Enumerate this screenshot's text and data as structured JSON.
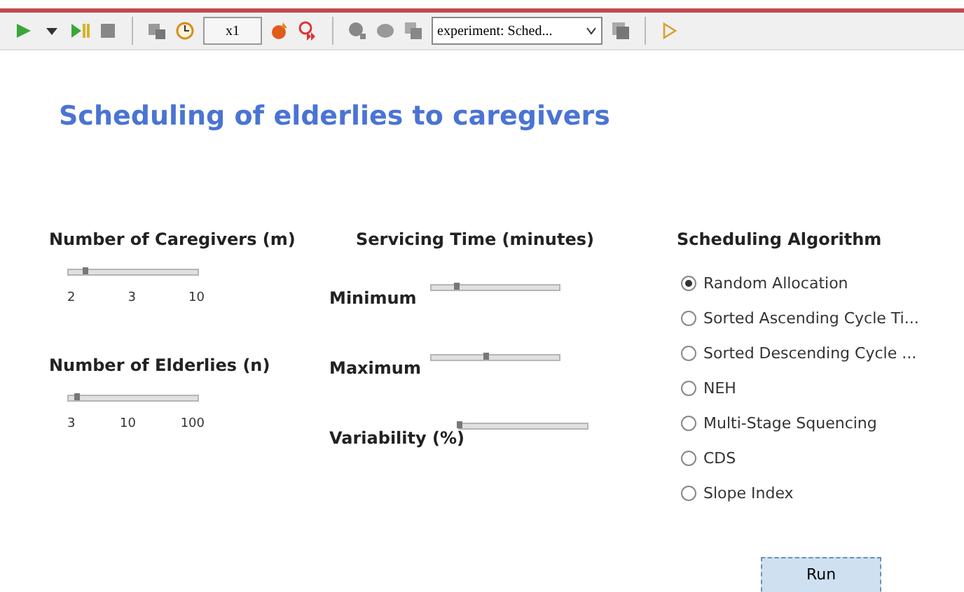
{
  "toolbar": {
    "speed": "x1",
    "experiment": "experiment: Sched..."
  },
  "title": "Scheduling of elderlies to caregivers",
  "left": [
    {
      "heading": "Number of Caregivers (m)",
      "level": 0.13,
      "ticks": [
        "2",
        "3",
        "10"
      ]
    },
    {
      "heading": "Number of Elderlies (n)",
      "level": 0.06,
      "ticks": [
        "3",
        "10",
        "100"
      ]
    }
  ],
  "servicing": {
    "heading": "Servicing Time (minutes)",
    "sliders": [
      {
        "label": "Minimum",
        "level": 0.2
      },
      {
        "label": "Maximum",
        "level": 0.43
      },
      {
        "label": "Variability (%)",
        "level": 0
      }
    ]
  },
  "algorithm": {
    "heading": "Scheduling Algorithm",
    "options": [
      {
        "label": "Random Allocation",
        "selected": true
      },
      {
        "label": "Sorted Ascending Cycle Ti...",
        "selected": false
      },
      {
        "label": "Sorted Descending Cycle ...",
        "selected": false
      },
      {
        "label": "NEH",
        "selected": false
      },
      {
        "label": "Multi-Stage Squencing",
        "selected": false
      },
      {
        "label": "CDS",
        "selected": false
      },
      {
        "label": "Slope Index",
        "selected": false
      }
    ]
  },
  "run_button": "Run"
}
